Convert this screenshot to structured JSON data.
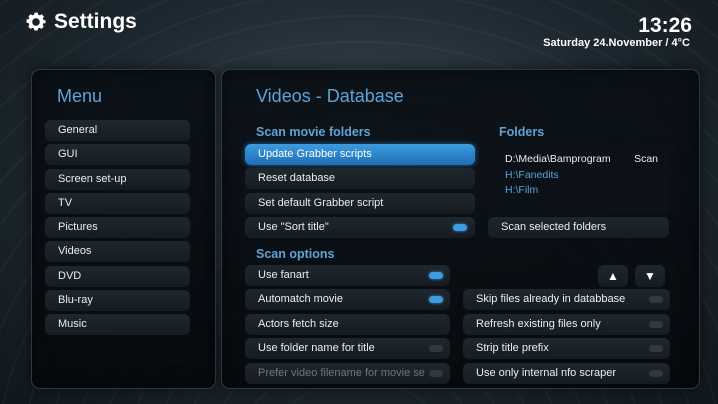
{
  "header": {
    "title": "Settings",
    "clock": "13:26",
    "date": "Saturday 24.November / 4°C"
  },
  "menu": {
    "heading": "Menu",
    "items": [
      "General",
      "GUI",
      "Screen set-up",
      "TV",
      "Pictures",
      "Videos",
      "DVD",
      "Blu-ray",
      "Music"
    ]
  },
  "main": {
    "heading": "Videos - Database",
    "scan_movie_folders": {
      "heading": "Scan movie folders",
      "update_grabber": "Update Grabber scripts",
      "reset_db": "Reset database",
      "set_default_grabber": "Set default Grabber script",
      "sort_title": "Use \"Sort title\""
    },
    "folders": {
      "heading": "Folders",
      "paths": [
        "D:\\Media\\Bamprogram",
        "H:\\Fanedits",
        "H:\\Film"
      ],
      "scan_label": "Scan",
      "scan_selected": "Scan selected folders"
    },
    "scan_options": {
      "heading": "Scan options",
      "use_fanart": "Use fanart",
      "automatch_movie": "Automatch movie",
      "actors_fetch_size": "Actors fetch size",
      "use_folder_name": "Use folder name for title",
      "prefer_video_filename": "Prefer video filename for movie se",
      "skip_files": "Skip files already in databbase",
      "refresh_existing": "Refresh existing files only",
      "strip_title_prefix": "Strip title prefix",
      "use_internal_nfo": "Use only internal nfo scraper",
      "up_arrow": "▲",
      "down_arrow": "▼"
    }
  },
  "colors": {
    "accent": "#5fa3d6",
    "selected": "#3d9be0"
  }
}
